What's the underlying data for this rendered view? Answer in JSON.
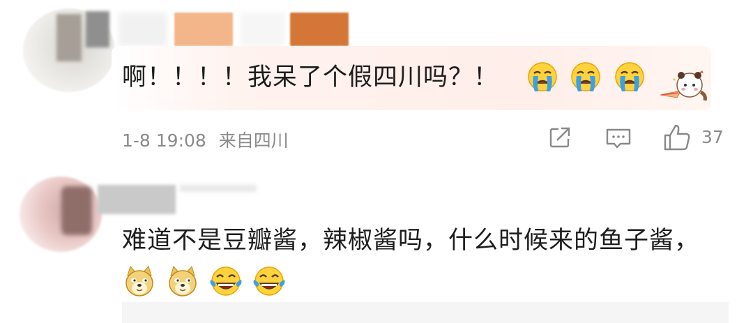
{
  "comments": [
    {
      "text": "啊！！！！我呆了个假四川吗？！",
      "emojis": [
        "crying-emoji",
        "crying-emoji",
        "crying-emoji"
      ],
      "decoration": "panda-sticker-icon",
      "time": "1-8 19:08",
      "location": "来自四川",
      "like_count": "37"
    },
    {
      "text": "难道不是豆瓣酱，辣椒酱吗，什么时候来的鱼子酱，",
      "emojis": [
        "doge-emoji",
        "doge-emoji",
        "laugh-cry-emoji",
        "laugh-cry-emoji"
      ]
    }
  ],
  "colors": {
    "meta_text": "#8a8a8a",
    "highlight_bg": "#ffeeea",
    "emoji_yellow": "#ffd23e",
    "tear_blue": "#3aa0e8"
  }
}
